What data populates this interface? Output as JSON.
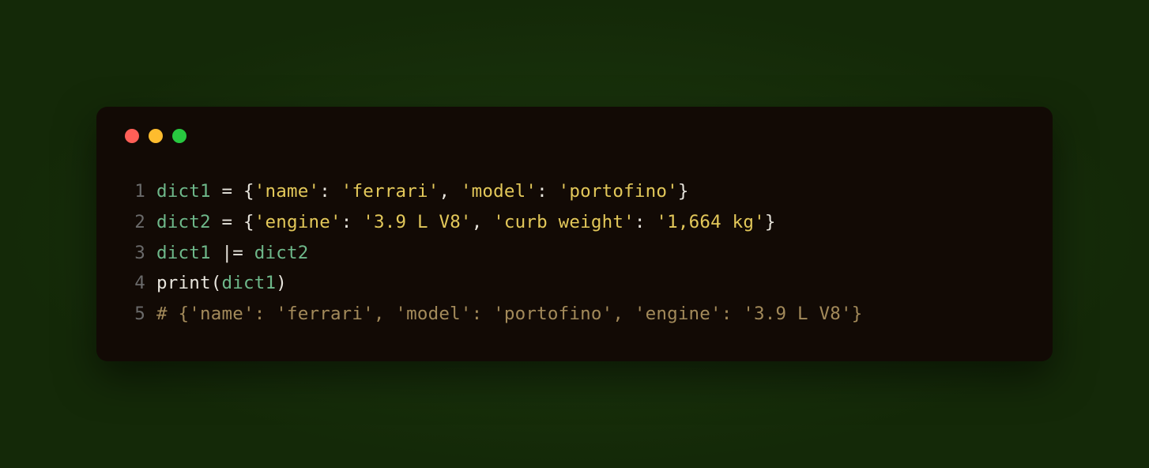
{
  "window": {
    "traffic_lights": {
      "red": "close",
      "yellow": "minimize",
      "green": "maximize"
    }
  },
  "code": {
    "lines": [
      {
        "num": "1",
        "tokens": [
          {
            "t": "dict1",
            "c": "c-var"
          },
          {
            "t": " ",
            "c": "c-op"
          },
          {
            "t": "=",
            "c": "c-op"
          },
          {
            "t": " {",
            "c": "c-punc"
          },
          {
            "t": "'name'",
            "c": "c-str"
          },
          {
            "t": ": ",
            "c": "c-punc"
          },
          {
            "t": "'ferrari'",
            "c": "c-str"
          },
          {
            "t": ", ",
            "c": "c-punc"
          },
          {
            "t": "'model'",
            "c": "c-str"
          },
          {
            "t": ": ",
            "c": "c-punc"
          },
          {
            "t": "'portofino'",
            "c": "c-str"
          },
          {
            "t": "}",
            "c": "c-punc"
          }
        ]
      },
      {
        "num": "2",
        "tokens": [
          {
            "t": "dict2",
            "c": "c-var"
          },
          {
            "t": " ",
            "c": "c-op"
          },
          {
            "t": "=",
            "c": "c-op"
          },
          {
            "t": " {",
            "c": "c-punc"
          },
          {
            "t": "'engine'",
            "c": "c-str"
          },
          {
            "t": ": ",
            "c": "c-punc"
          },
          {
            "t": "'3.9 L V8'",
            "c": "c-str"
          },
          {
            "t": ", ",
            "c": "c-punc"
          },
          {
            "t": "'curb weight'",
            "c": "c-str"
          },
          {
            "t": ": ",
            "c": "c-punc"
          },
          {
            "t": "'1,664 kg'",
            "c": "c-str"
          },
          {
            "t": "}",
            "c": "c-punc"
          }
        ]
      },
      {
        "num": "3",
        "tokens": [
          {
            "t": "dict1",
            "c": "c-var"
          },
          {
            "t": " ",
            "c": "c-op"
          },
          {
            "t": "|=",
            "c": "c-op"
          },
          {
            "t": " ",
            "c": "c-op"
          },
          {
            "t": "dict2",
            "c": "c-var"
          }
        ]
      },
      {
        "num": "4",
        "tokens": [
          {
            "t": "print",
            "c": "c-func"
          },
          {
            "t": "(",
            "c": "c-punc"
          },
          {
            "t": "dict1",
            "c": "c-var"
          },
          {
            "t": ")",
            "c": "c-punc"
          }
        ]
      },
      {
        "num": "5",
        "tokens": [
          {
            "t": "# {'name': 'ferrari', 'model': 'portofino', 'engine': '3.9 L V8'}",
            "c": "c-comment"
          }
        ]
      }
    ]
  }
}
